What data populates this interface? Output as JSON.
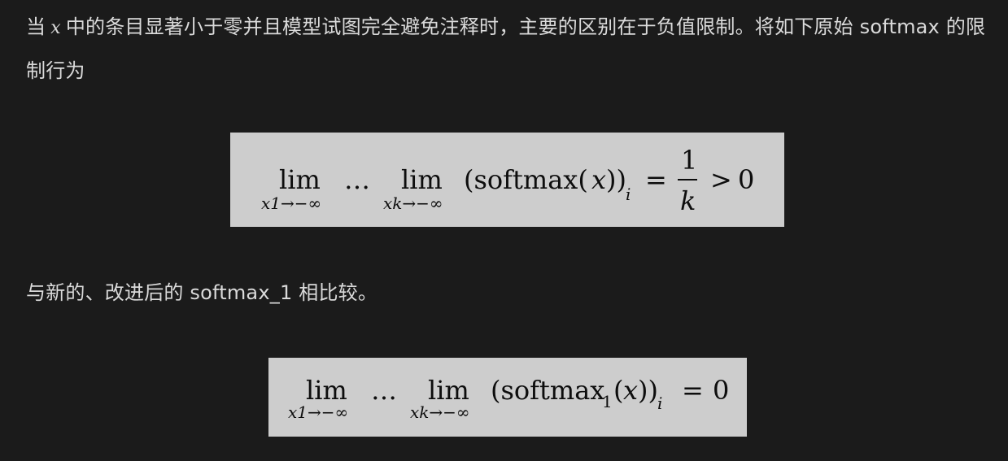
{
  "paragraph1": {
    "prefix": "当",
    "variable": "x",
    "text": "中的条目显著小于零并且模型试图完全避免注释时，主要的区别在于负值限制。将如下原始 softmax 的限制行为"
  },
  "equation1": {
    "lim_word": "lim",
    "lim1_sub": "x1→−∞",
    "dots": "…",
    "lim2_sub": "xk→−∞",
    "open": "(softmax(",
    "var_x": "x",
    "close": "))",
    "index": "i",
    "equals": "=",
    "numerator": "1",
    "denominator": "k",
    "greater": ">",
    "zero": "0"
  },
  "paragraph2": {
    "text": "与新的、改进后的 softmax_1 相比较。"
  },
  "equation2": {
    "lim_word": "lim",
    "lim1_sub": "x1→−∞",
    "dots": "…",
    "lim2_sub": "xk→−∞",
    "open": "(softmax",
    "sub1": "1",
    "mid": "(",
    "var_x": "x",
    "close": "))",
    "index": "i",
    "equals": "=",
    "zero": "0"
  }
}
